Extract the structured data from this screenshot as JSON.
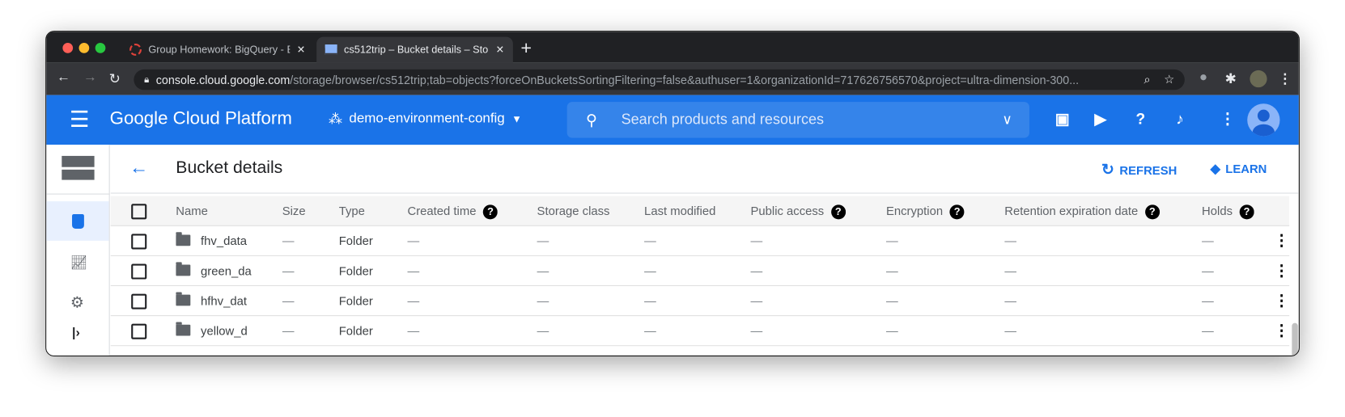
{
  "browser": {
    "tabs": [
      {
        "title": "Group Homework: BigQuery - B",
        "active": false,
        "icon": "loading-spinner-icon"
      },
      {
        "title": "cs512trip – Bucket details – Sto",
        "active": true,
        "icon": "storage-icon"
      }
    ],
    "new_tab": "+",
    "close": "✕",
    "url_domain": "console.cloud.google.com",
    "url_path": "/storage/browser/cs512trip;tab=objects?forceOnBucketsSortingFiltering=false&authuser=1&organizationId=717626756570&project=ultra-dimension-300..."
  },
  "gcp": {
    "title": "Google Cloud Platform",
    "project": "demo-environment-config",
    "search_placeholder": "Search products and resources",
    "brand_color": "#1a73e8"
  },
  "page": {
    "title": "Bucket details",
    "refresh": "REFRESH",
    "learn": "LEARN"
  },
  "table": {
    "columns": [
      "Name",
      "Size",
      "Type",
      "Created time",
      "Storage class",
      "Last modified",
      "Public access",
      "Encryption",
      "Retention expiration date",
      "Holds"
    ],
    "rows": [
      {
        "name": "fhv_data",
        "size": "—",
        "type": "Folder",
        "created": "—",
        "storage": "—",
        "modified": "—",
        "public": "—",
        "encryption": "—",
        "retention": "—",
        "holds": "—"
      },
      {
        "name": "green_da",
        "size": "—",
        "type": "Folder",
        "created": "—",
        "storage": "—",
        "modified": "—",
        "public": "—",
        "encryption": "—",
        "retention": "—",
        "holds": "—"
      },
      {
        "name": "hfhv_dat",
        "size": "—",
        "type": "Folder",
        "created": "—",
        "storage": "—",
        "modified": "—",
        "public": "—",
        "encryption": "—",
        "retention": "—",
        "holds": "—"
      },
      {
        "name": "yellow_d",
        "size": "—",
        "type": "Folder",
        "created": "—",
        "storage": "—",
        "modified": "—",
        "public": "—",
        "encryption": "—",
        "retention": "—",
        "holds": "—"
      }
    ]
  }
}
